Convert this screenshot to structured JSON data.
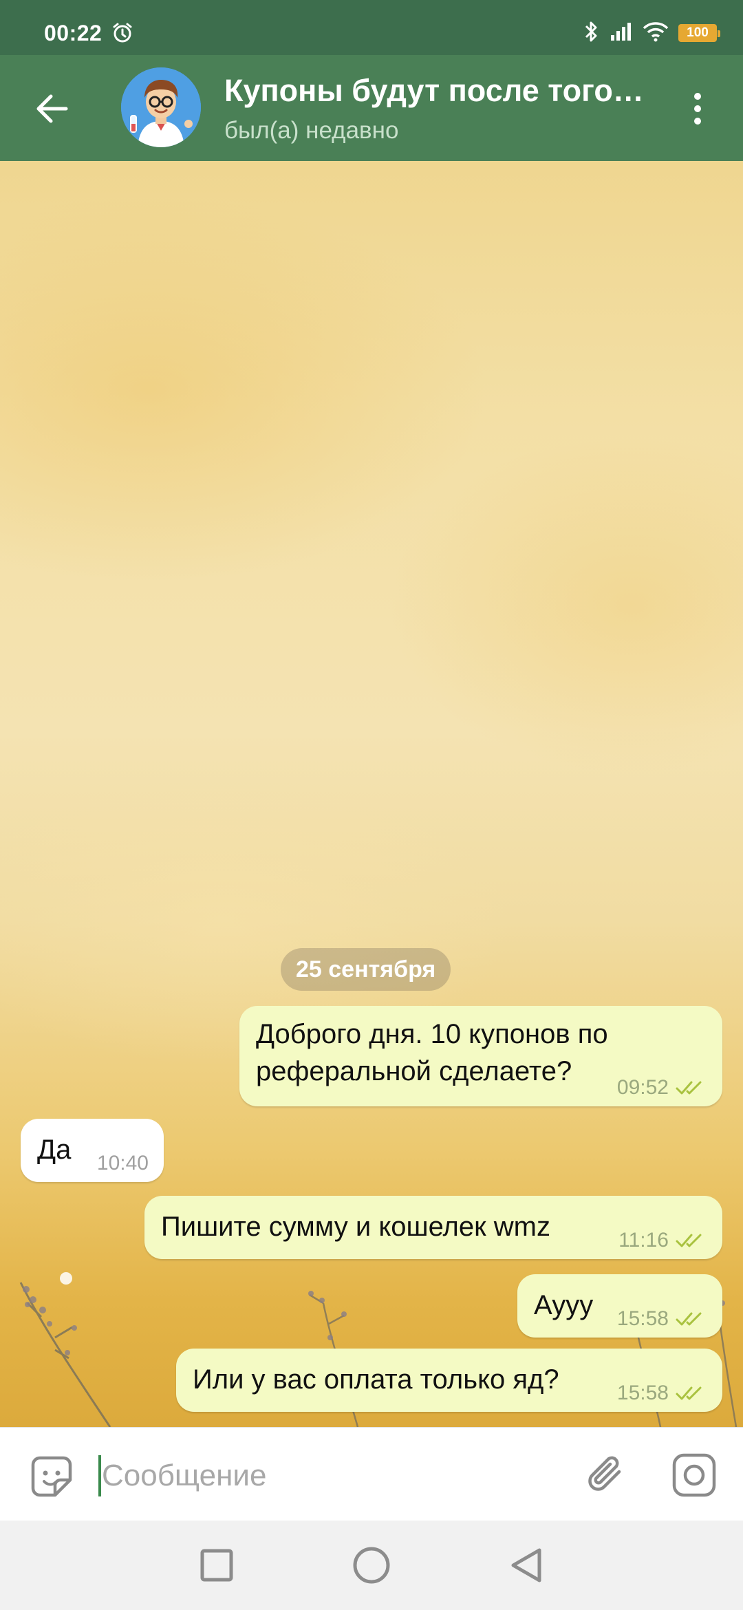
{
  "status_bar": {
    "time": "00:22",
    "battery_level": "100",
    "icons": [
      "alarm-icon",
      "bluetooth-icon",
      "signal-icon",
      "wifi-icon",
      "battery-icon"
    ]
  },
  "header": {
    "title": "Купоны будут после того…",
    "subtitle": "был(а) недавно",
    "back_icon": "arrow-left-icon",
    "menu_icon": "more-vertical-icon"
  },
  "chat": {
    "date_separator": "25 сентября",
    "messages": [
      {
        "direction": "outgoing",
        "lines": [
          "Доброго дня. 10 купонов по",
          "реферальной сделаете?"
        ],
        "time": "09:52",
        "status": "read"
      },
      {
        "direction": "incoming",
        "lines": [
          "Да"
        ],
        "time": "10:40"
      },
      {
        "direction": "outgoing",
        "lines": [
          "Пишите сумму и кошелек wmz"
        ],
        "time": "11:16",
        "status": "read"
      },
      {
        "direction": "outgoing",
        "lines": [
          "Аууу"
        ],
        "time": "15:58",
        "status": "read"
      },
      {
        "direction": "outgoing",
        "lines": [
          "Или у вас оплата только яд?"
        ],
        "time": "15:58",
        "status": "read"
      }
    ]
  },
  "input_bar": {
    "placeholder": "Сообщение",
    "icons": [
      "sticker-icon",
      "attach-icon",
      "camera-icon"
    ]
  },
  "nav_bar": {
    "icons": [
      "recents-square-icon",
      "home-circle-icon",
      "back-triangle-icon"
    ]
  },
  "colors": {
    "header_bg": "#4a8056",
    "status_bar_bg": "#3d6e4d",
    "outgoing_bubble": "#f4fac4",
    "incoming_bubble": "#ffffff",
    "read_check": "#a9c23f"
  }
}
